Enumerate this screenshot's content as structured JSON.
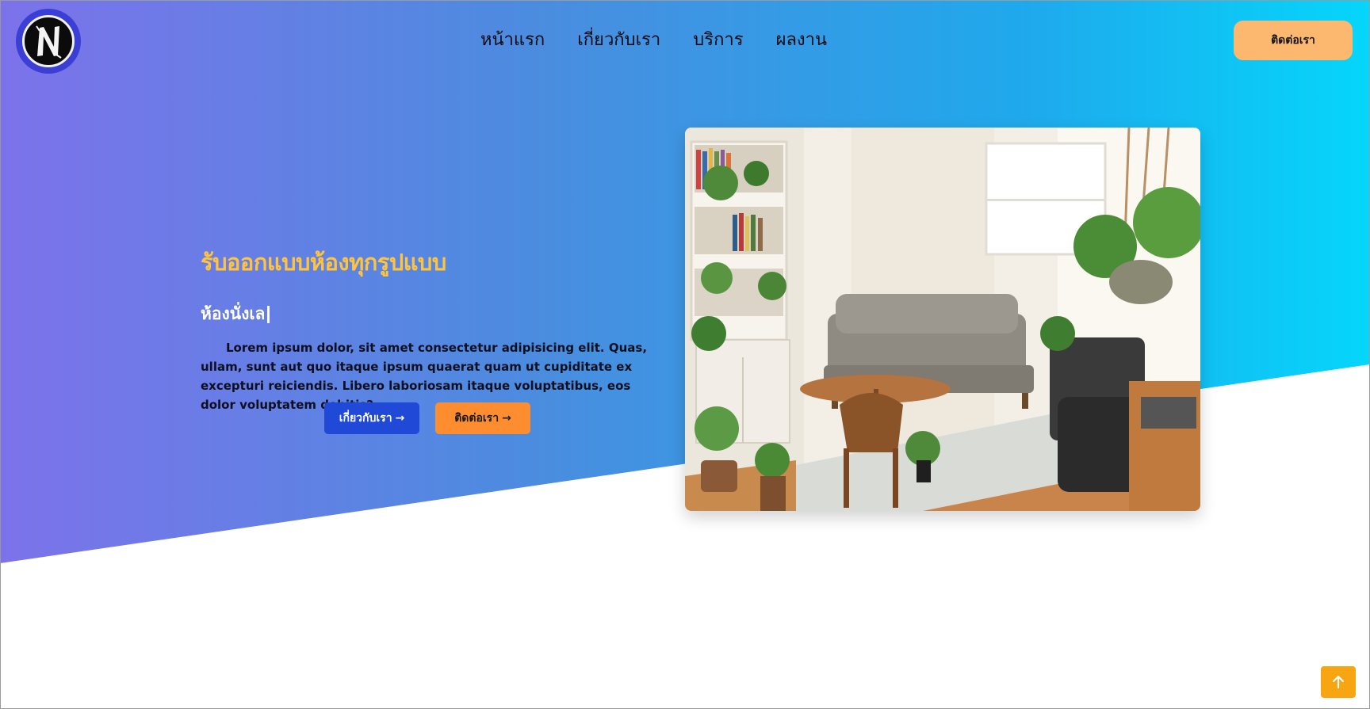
{
  "logo": {
    "letter": "N",
    "icon": "brand-logo-icon"
  },
  "nav": {
    "items": [
      {
        "label": "หน้าแรก"
      },
      {
        "label": "เกี่ยวกับเรา"
      },
      {
        "label": "บริการ"
      },
      {
        "label": "ผลงาน"
      }
    ],
    "contact_label": "ติดต่อเรา"
  },
  "hero": {
    "title": "รับออกแบบห้องทุกรูปแบบ",
    "subtitle": "ห้องนั่งเล",
    "description": "Lorem ipsum dolor, sit amet consectetur adipisicing elit. Quas, ullam, sunt aut quo itaque ipsum quaerat quam ut cupiditate ex excepturi reiciendis. Libero laboriosam itaque voluptatibus, eos dolor voluptatem debitis?",
    "about_button": "เกี่ยวกับเรา",
    "contact_button": "ติดต่อเรา",
    "arrow": "→",
    "image": "living-room-photo"
  },
  "scroll_top": {
    "icon": "arrow-up-icon"
  },
  "colors": {
    "gradient_start": "#7d72ea",
    "gradient_end": "#05d6fb",
    "title": "#ffc43c",
    "about_button": "#1f49d6",
    "contact_button": "#fd8d2f",
    "nav_contact": "#fcb86e",
    "scroll_top": "#f7a510"
  }
}
